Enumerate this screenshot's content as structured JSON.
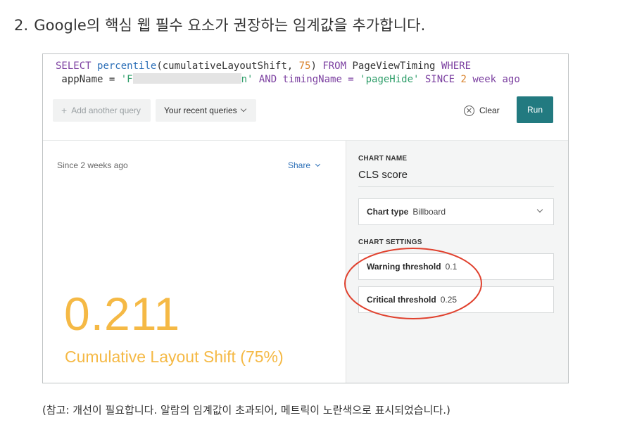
{
  "heading": {
    "number": "2.",
    "text": "Google의 핵심 웹 필수 요소가 권장하는 임계값을 추가합니다."
  },
  "query": {
    "select": "SELECT",
    "func": "percentile",
    "args": "(cumulativeLayoutShift, ",
    "pct": "75",
    "close": ") ",
    "from": "FROM",
    "table": " PageViewTiming ",
    "where": "WHERE",
    "line2_start": " appName = ",
    "str_open": "'F",
    "str_close": "n'",
    "and": " AND timingName = ",
    "page_hide": "'pageHide'",
    "since": " SINCE ",
    "since_num": "2",
    "week": " week ago"
  },
  "toolbar": {
    "add_query": "Add another query",
    "recent_queries": "Your recent queries",
    "clear": "Clear",
    "run": "Run"
  },
  "chart": {
    "since": "Since 2 weeks ago",
    "share": "Share",
    "value": "0.211",
    "label": "Cumulative Layout Shift (75%)",
    "value_color": "#f5b945"
  },
  "settings": {
    "chart_name_label": "CHART NAME",
    "chart_name": "CLS score",
    "chart_type_label": "Chart type",
    "chart_type": "Billboard",
    "chart_settings_label": "CHART SETTINGS",
    "warning_label": "Warning threshold",
    "warning_value": "0.1",
    "critical_label": "Critical threshold",
    "critical_value": "0.25"
  },
  "annotation_color": "#e0412e",
  "footnote": "(참고: 개선이 필요합니다. 알람의 임계값이 초과되어, 메트릭이 노란색으로 표시되었습니다.)"
}
